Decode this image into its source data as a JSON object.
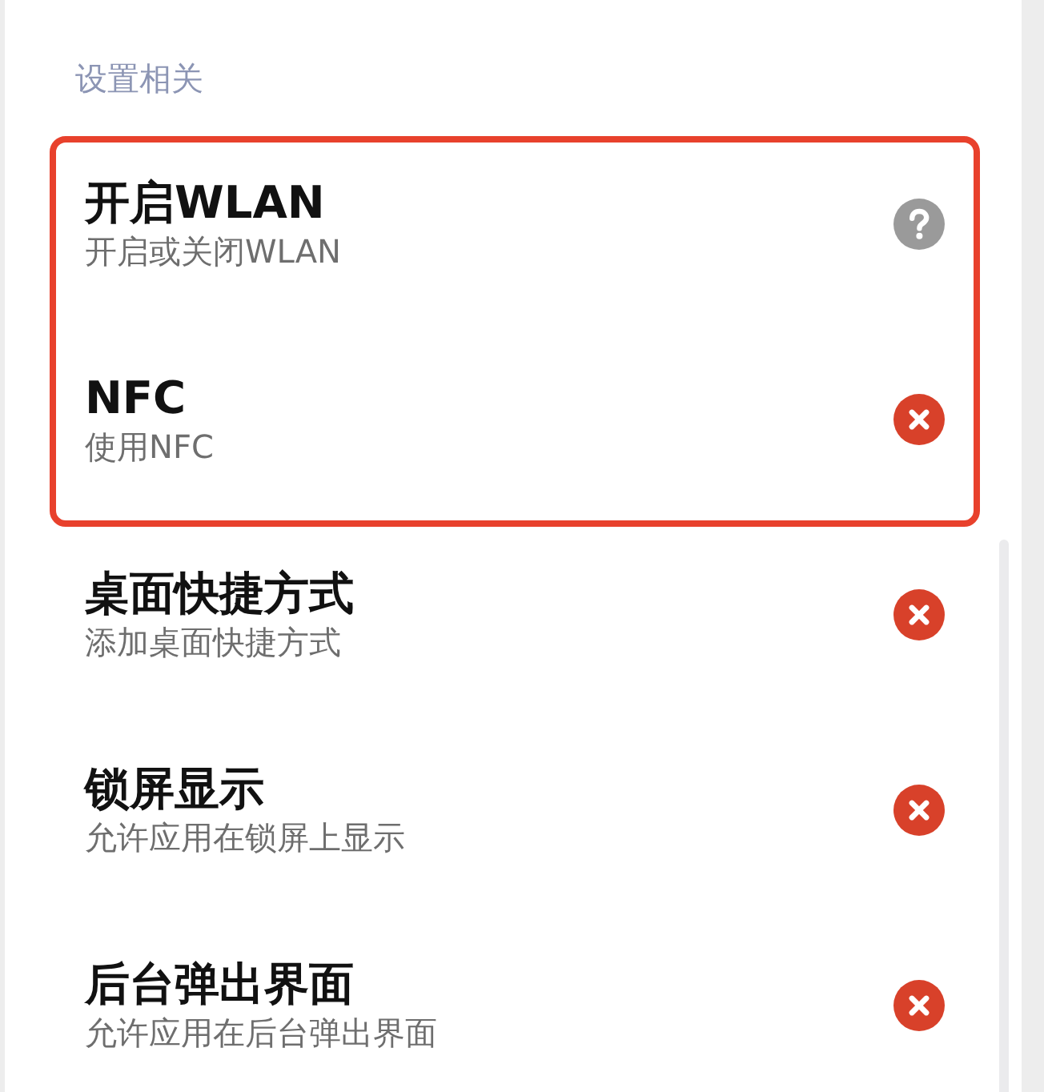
{
  "section_title": "设置相关",
  "highlighted_group": {
    "items": [
      {
        "title": "开启WLAN",
        "subtitle": "开启或关闭WLAN",
        "denied": false
      },
      {
        "title": "NFC",
        "subtitle": "使用NFC",
        "denied": true
      }
    ]
  },
  "items": [
    {
      "title": "桌面快捷方式",
      "subtitle": "添加桌面快捷方式",
      "denied": true
    },
    {
      "title": "锁屏显示",
      "subtitle": "允许应用在锁屏上显示",
      "denied": true
    },
    {
      "title": "后台弹出界面",
      "subtitle": "允许应用在后台弹出界面",
      "denied": true
    }
  ]
}
